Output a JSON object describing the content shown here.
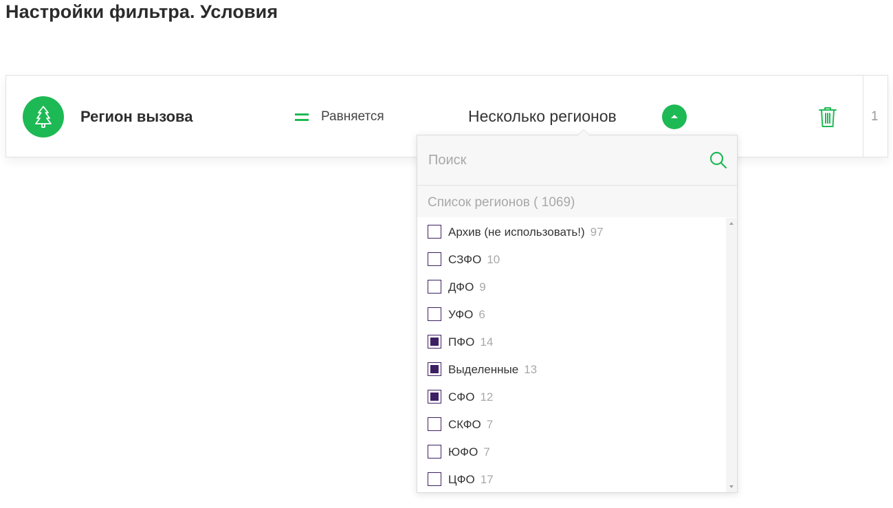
{
  "page": {
    "title": "Настройки фильтра. Условия"
  },
  "condition": {
    "field_icon": "tree-icon",
    "field_name": "Регион вызова",
    "operator_icon": "equals-icon",
    "operator_label": "Равняется",
    "value_label": "Несколько регионов",
    "toggle_icon": "caret-up-icon",
    "delete_icon": "trash-icon",
    "row_number": "1"
  },
  "dropdown": {
    "search_placeholder": "Поиск",
    "search_icon": "search-icon",
    "list_header": "Список регионов ( 1069)",
    "items": [
      {
        "label": "Архив (не использовать!)",
        "count": "97",
        "checked": false
      },
      {
        "label": "СЗФО",
        "count": "10",
        "checked": false
      },
      {
        "label": "ДФО",
        "count": "9",
        "checked": false
      },
      {
        "label": "УФО",
        "count": "6",
        "checked": false
      },
      {
        "label": "ПФО",
        "count": "14",
        "checked": true
      },
      {
        "label": "Выделенные",
        "count": "13",
        "checked": true
      },
      {
        "label": "СФО",
        "count": "12",
        "checked": true
      },
      {
        "label": "СКФО",
        "count": "7",
        "checked": false
      },
      {
        "label": "ЮФО",
        "count": "7",
        "checked": false
      },
      {
        "label": "ЦФО",
        "count": "17",
        "checked": false
      }
    ]
  },
  "colors": {
    "accent": "#1db954",
    "checkbox": "#3d1f63",
    "muted_text": "#a8a8a8"
  }
}
